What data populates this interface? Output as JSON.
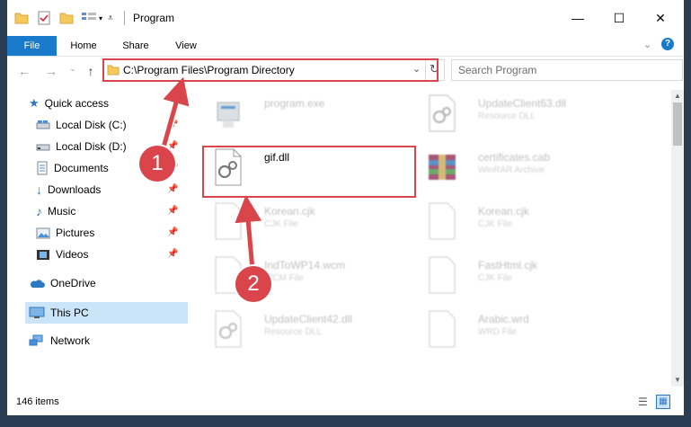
{
  "window": {
    "title": "Program",
    "controls": {
      "minimize_icon": "minimize-icon",
      "maximize_icon": "maximize-icon",
      "close_icon": "close-icon"
    }
  },
  "ribbon": {
    "tabs": [
      {
        "label": "File"
      },
      {
        "label": "Home"
      },
      {
        "label": "Share"
      },
      {
        "label": "View"
      }
    ]
  },
  "address": {
    "path": "C:\\Program Files\\Program Directory",
    "search_placeholder": "Search Program"
  },
  "nav": {
    "items": [
      {
        "label": "Quick access",
        "icon": "star-icon",
        "pinned": false
      },
      {
        "label": "Local Disk (C:)",
        "icon": "drive-icon",
        "pinned": true
      },
      {
        "label": "Local Disk (D:)",
        "icon": "drive-icon",
        "pinned": true
      },
      {
        "label": "Documents",
        "icon": "document-icon",
        "pinned": true
      },
      {
        "label": "Downloads",
        "icon": "download-icon",
        "pinned": true
      },
      {
        "label": "Music",
        "icon": "music-icon",
        "pinned": true
      },
      {
        "label": "Pictures",
        "icon": "picture-icon",
        "pinned": true
      },
      {
        "label": "Videos",
        "icon": "video-icon",
        "pinned": true
      },
      {
        "label": "OneDrive",
        "icon": "cloud-icon",
        "pinned": false
      },
      {
        "label": "This PC",
        "icon": "computer-icon",
        "pinned": false,
        "selected": true
      },
      {
        "label": "Network",
        "icon": "network-icon",
        "pinned": false
      }
    ]
  },
  "files": [
    {
      "name": "program.exe",
      "type": ""
    },
    {
      "name": "UpdateClient63.dll",
      "type": "Resource DLL"
    },
    {
      "name": "gif.dll",
      "type": "",
      "highlighted": true
    },
    {
      "name": "certificates.cab",
      "type": "WinRAR Archive"
    },
    {
      "name": "Korean.cjk",
      "type": "CJK File"
    },
    {
      "name": "Korean.cjk",
      "type": "CJK File"
    },
    {
      "name": "IndToWP14.wcm",
      "type": "WCM File"
    },
    {
      "name": "FastHtml.cjk",
      "type": "CJK File"
    },
    {
      "name": "UpdateClient42.dll",
      "type": "Resource DLL"
    },
    {
      "name": "Arabic.wrd",
      "type": "WRD File"
    }
  ],
  "status": {
    "items_count": "146 items"
  },
  "annotations": {
    "badge1": "1",
    "badge2": "2",
    "color": "#d9454a"
  }
}
